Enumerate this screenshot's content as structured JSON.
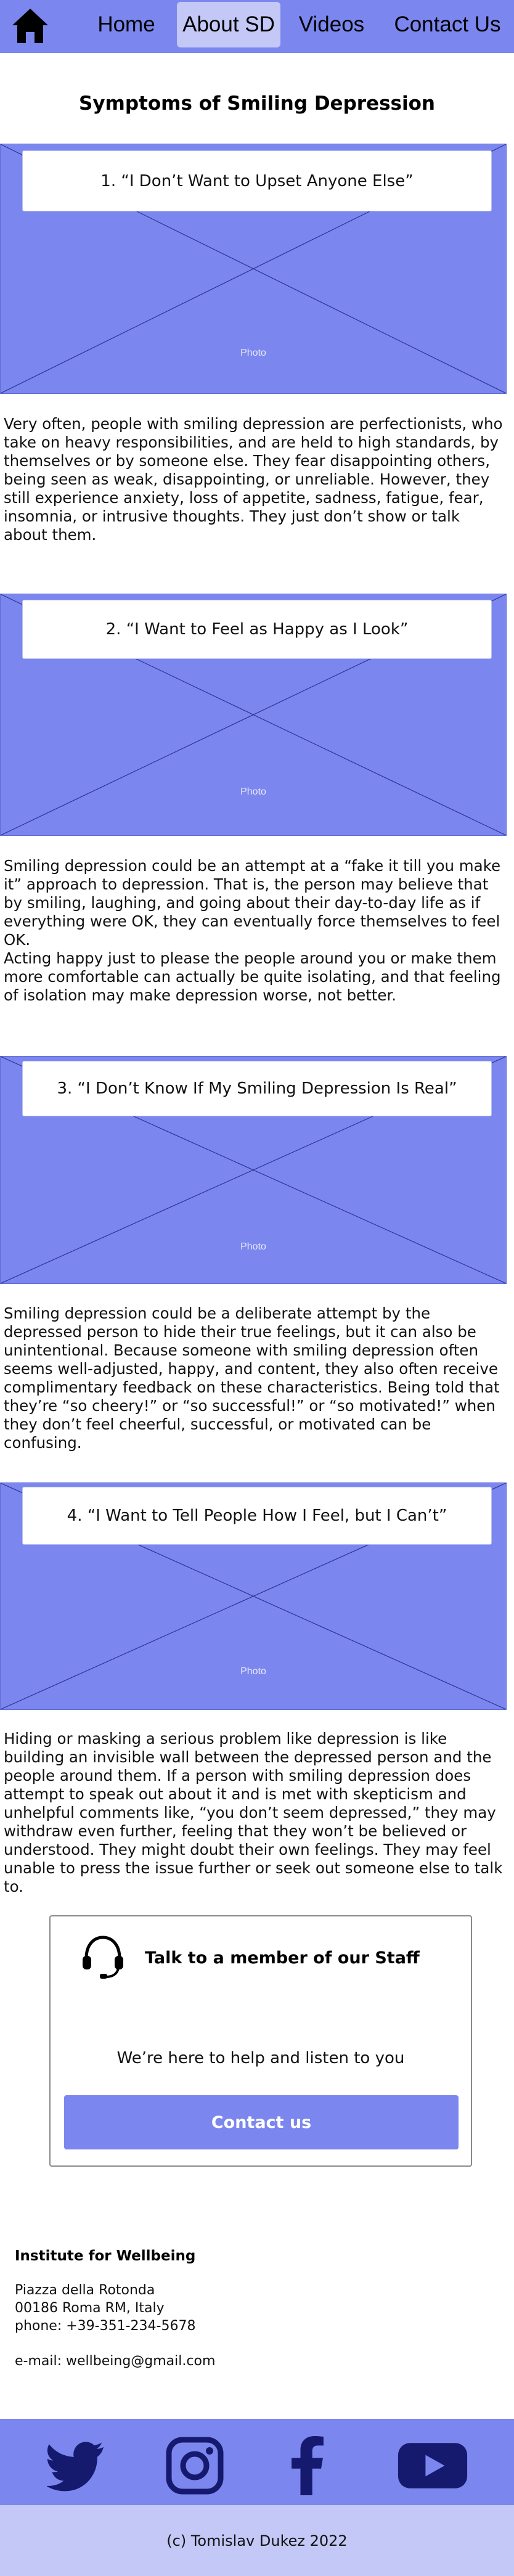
{
  "nav": {
    "home_icon": "home-icon",
    "items": [
      {
        "label": "Home"
      },
      {
        "label": "About SD",
        "active": true
      },
      {
        "label": "Videos"
      },
      {
        "label": "Contact Us"
      }
    ],
    "colors": {
      "bar": "#7b87ee",
      "active": "#c3c8f6"
    }
  },
  "page": {
    "title": "Symptoms of Smiling Depression"
  },
  "sections": [
    {
      "heading": "1. “I Don’t Want to Upset Anyone Else”",
      "photo_label": "Photo",
      "text": "Very often, people with smiling depression are perfectionists, who take on heavy responsibilities, and are held to high standards, by themselves or by someone else. They  fear disappointing others, being seen as weak, disappointing, or unreliable. However, they still experience anxiety, loss of appetite, sadness, fatigue, fear, insomnia, or intrusive thoughts. They just don’t show or talk about them."
    },
    {
      "heading": "2. “I Want to Feel as Happy as I Look”",
      "photo_label": "Photo",
      "text": "Smiling depression could be an attempt at a “fake it till you make it” approach to depression. That is, the person may believe that by smiling, laughing, and going about their day-to-day life as if everything were OK, they can eventually force themselves to feel OK.\nActing happy just to please the people around you or make them more comfortable can actually be quite isolating, and that feeling of isolation may make depression worse, not better."
    },
    {
      "heading": "3. “I Don’t Know If My Smiling Depression Is Real”",
      "photo_label": "Photo",
      "text": "Smiling depression could be a deliberate attempt by the depressed person to hide their true feelings, but it can also be unintentional. Because someone with smiling depression often seems well-adjusted, happy, and content, they also often receive complimentary feedback on these characteristics. Being told that they’re “so cheery!” or “so successful!” or “so motivated!” when they don’t feel cheerful, successful, or motivated can be confusing."
    },
    {
      "heading": "4. “I Want to Tell People How I Feel, but I Can’t”",
      "photo_label": "Photo",
      "text": "Hiding or masking a serious problem like depression is like building an invisible wall between the depressed person and the people around them. If a person with smiling depression does attempt to speak out about it and is met with skepticism and unhelpful comments like, “you don’t seem depressed,” they may withdraw even further, feeling that they won’t be believed or understood. They might doubt their own feelings. They may feel unable to press the issue further or seek out someone else to talk to."
    }
  ],
  "staff_card": {
    "icon": "headset-icon",
    "title": "Talk to a member of our Staff",
    "subtitle": "We’re here to help and listen to you",
    "button_label": "Contact us"
  },
  "address": {
    "name": "Institute for Wellbeing",
    "street": "Piazza della Rotonda",
    "city": "00186 Roma RM, Italy",
    "phone": "phone: +39-351-234-5678",
    "email": "e-mail: wellbeing@gmail.com"
  },
  "social": {
    "icons": [
      "twitter-icon",
      "instagram-icon",
      "facebook-icon",
      "youtube-icon"
    ]
  },
  "footer": {
    "copyright": "(c) Tomislav Dukez 2022"
  }
}
